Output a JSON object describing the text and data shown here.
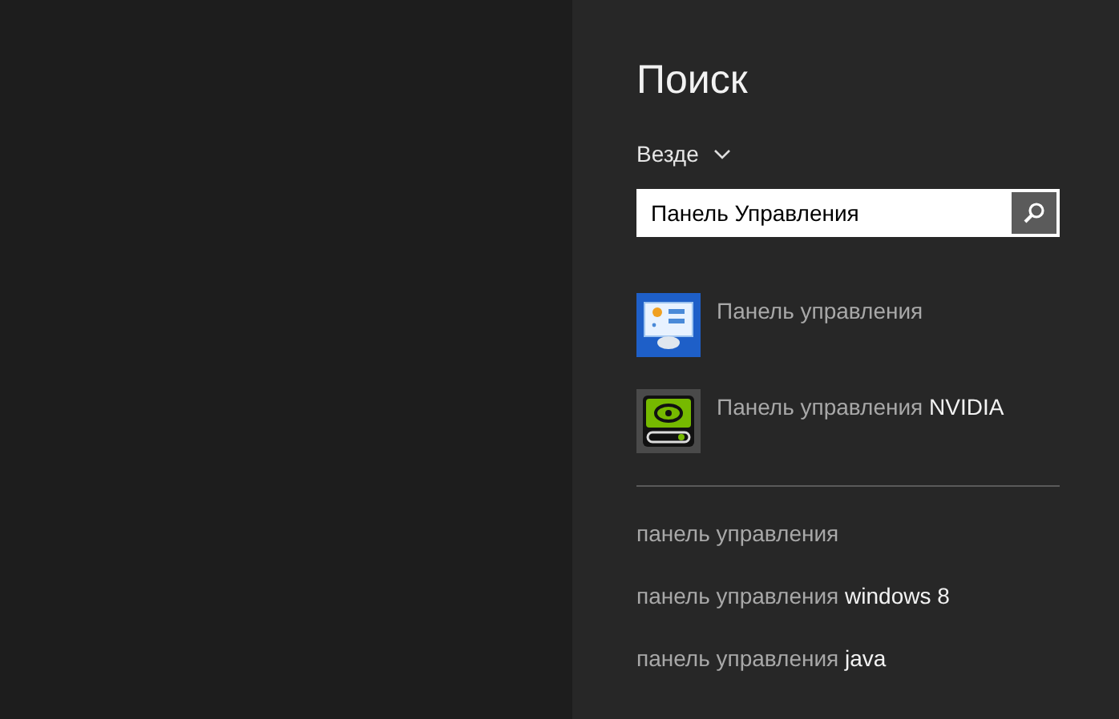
{
  "pane": {
    "title": "Поиск",
    "scope": "Везде"
  },
  "search": {
    "value": "Панель Управления"
  },
  "results": [
    {
      "kind": "control-panel",
      "label": "Панель управления"
    },
    {
      "kind": "nvidia",
      "label": "Панель управления",
      "extra": "NVIDIA"
    }
  ],
  "suggestions": [
    {
      "base": "панель управления"
    },
    {
      "base": "панель управления",
      "extra": "windows 8"
    },
    {
      "base": "панель управления",
      "extra": "java"
    }
  ]
}
